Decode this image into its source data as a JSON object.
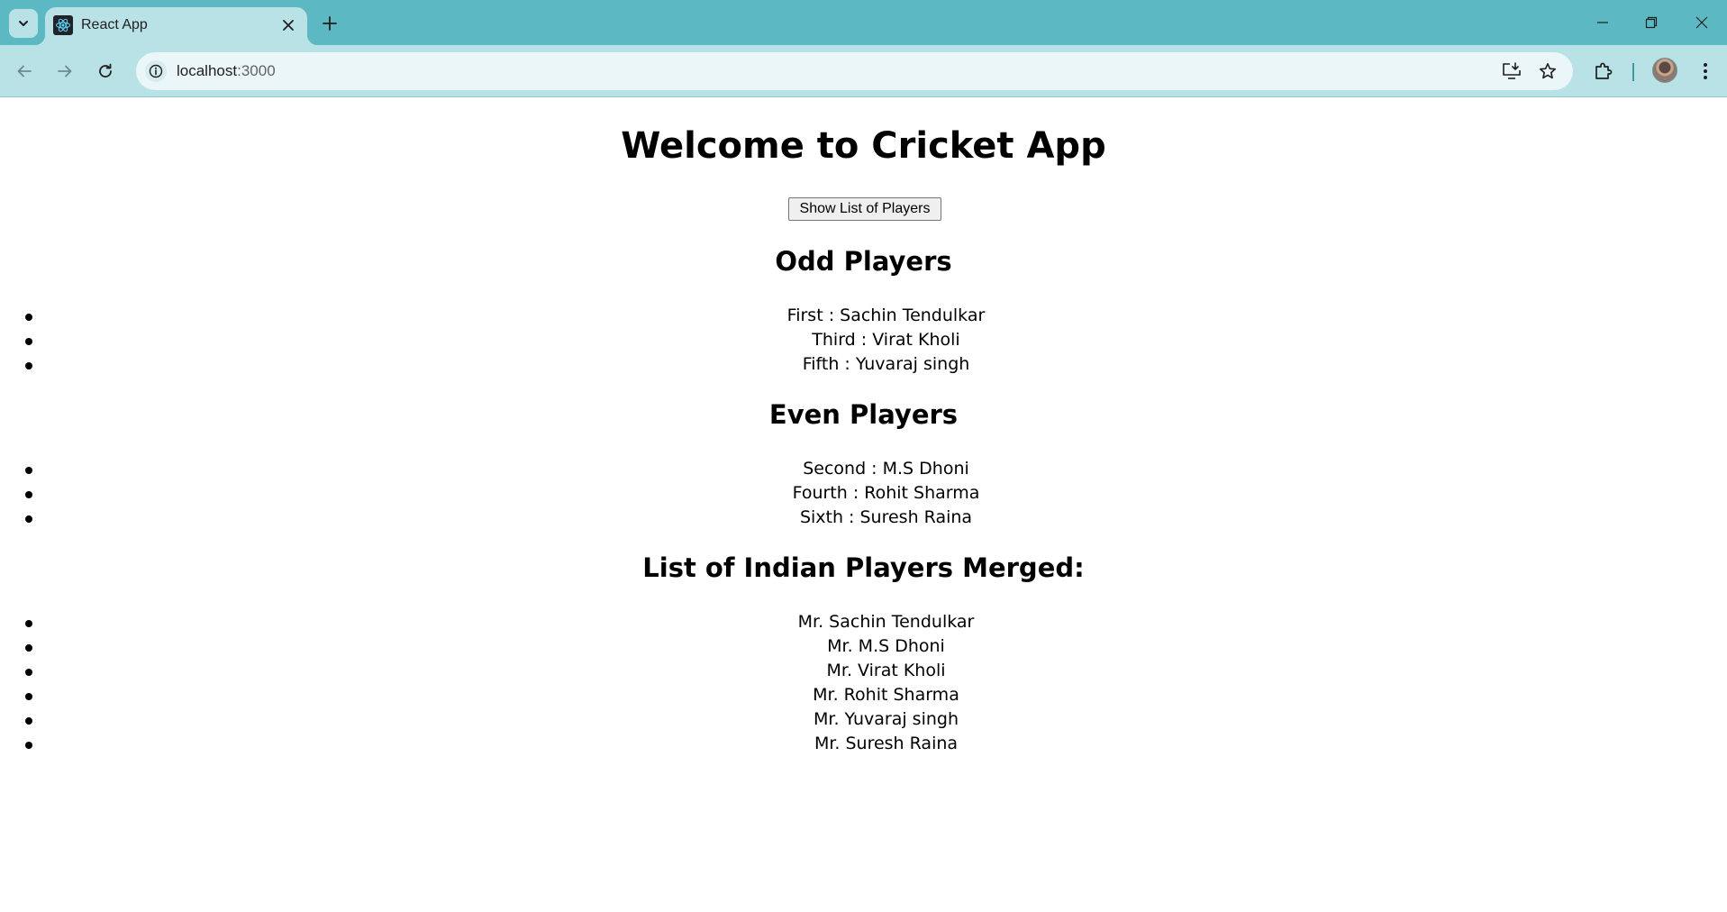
{
  "browser": {
    "tab_title": "React App",
    "url_host": "localhost",
    "url_port": ":3000"
  },
  "page": {
    "title": "Welcome to Cricket App",
    "show_button_label": "Show List of Players",
    "odd_heading": "Odd Players",
    "odd_players": [
      "First : Sachin Tendulkar",
      "Third : Virat Kholi",
      "Fifth : Yuvaraj singh"
    ],
    "even_heading": "Even Players",
    "even_players": [
      "Second : M.S Dhoni",
      "Fourth : Rohit Sharma",
      "Sixth : Suresh Raina"
    ],
    "merged_heading": "List of Indian Players Merged:",
    "merged_players": [
      "Mr. Sachin Tendulkar",
      "Mr. M.S Dhoni",
      "Mr. Virat Kholi",
      "Mr. Rohit Sharma",
      "Mr. Yuvaraj singh",
      "Mr. Suresh Raina"
    ]
  }
}
